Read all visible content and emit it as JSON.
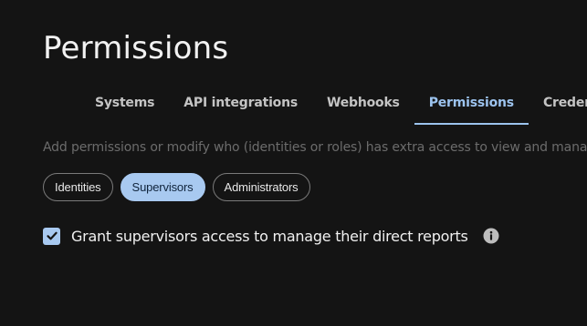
{
  "page": {
    "title": "Permissions",
    "description": "Add permissions or modify who (identities or roles) has extra access to view and manage identities"
  },
  "tabs": [
    {
      "label": "Systems",
      "active": false
    },
    {
      "label": "API integrations",
      "active": false
    },
    {
      "label": "Webhooks",
      "active": false
    },
    {
      "label": "Permissions",
      "active": true
    },
    {
      "label": "Credentials",
      "active": false
    }
  ],
  "chips": [
    {
      "label": "Identities",
      "selected": false
    },
    {
      "label": "Supervisors",
      "selected": true
    },
    {
      "label": "Administrators",
      "selected": false
    }
  ],
  "option": {
    "label": "Grant supervisors access to manage their direct reports",
    "checked": true,
    "info_icon": "info-icon"
  },
  "colors": {
    "background": "#141414",
    "accent": "#9cc3ee",
    "chip_selected_bg": "#a8c9f0",
    "muted_text": "#6c6c6c"
  }
}
